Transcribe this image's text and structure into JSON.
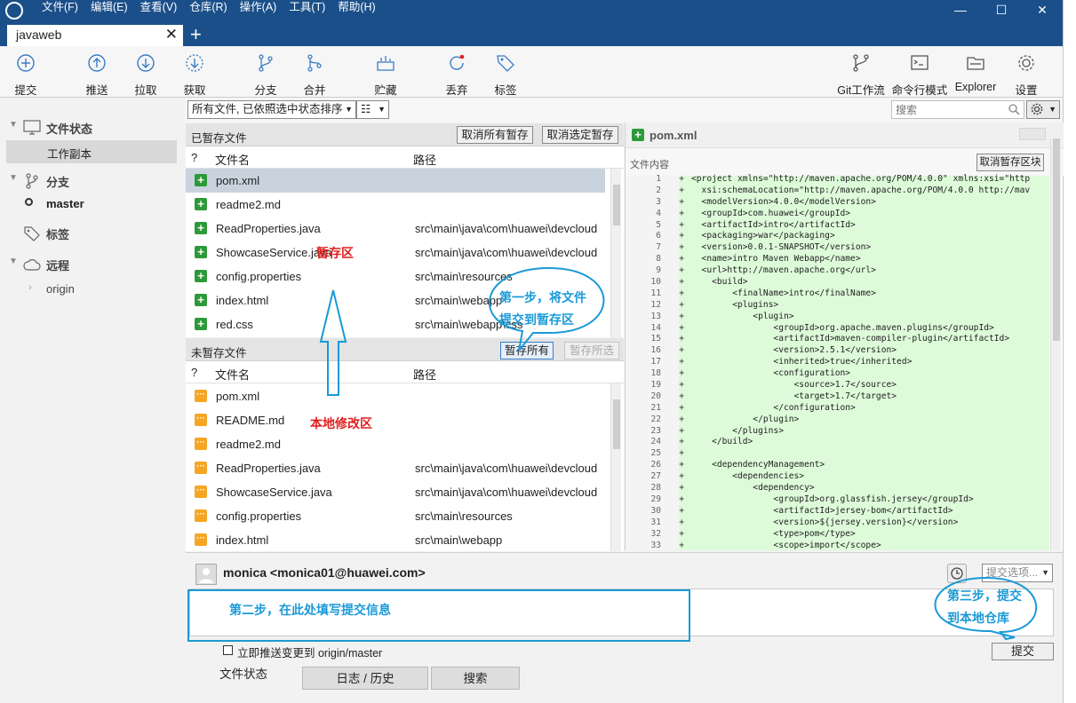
{
  "menu": [
    "文件(F)",
    "编辑(E)",
    "查看(V)",
    "仓库(R)",
    "操作(A)",
    "工具(T)",
    "帮助(H)"
  ],
  "window": {
    "minimize": "—",
    "maximize": "☐",
    "close": "✕"
  },
  "tab": {
    "label": "javaweb",
    "close": "✕",
    "add": "+"
  },
  "toolbar": {
    "commit": "提交",
    "push": "推送",
    "pull": "拉取",
    "fetch": "获取",
    "branch": "分支",
    "merge": "合并",
    "stash": "贮藏",
    "discard": "丢弃",
    "tag": "标签",
    "gitflow": "Git工作流",
    "terminal": "命令行模式",
    "explorer": "Explorer",
    "settings": "设置"
  },
  "sidebar": {
    "file_status": "文件状态",
    "working_copy": "工作副本",
    "branches": "分支",
    "master": "master",
    "tags": "标签",
    "remotes": "远程",
    "origin": "origin"
  },
  "filter": {
    "sort": "所有文件, 已依照选中状态排序",
    "list_icon": "☷",
    "search_placeholder": "搜索"
  },
  "staged": {
    "title": "已暂存文件",
    "unstage_all": "取消所有暂存",
    "unstage_selected": "取消选定暂存",
    "col_q": "?",
    "col_name": "文件名",
    "col_path": "路径",
    "files": [
      {
        "name": "pom.xml",
        "path": ""
      },
      {
        "name": "readme2.md",
        "path": ""
      },
      {
        "name": "ReadProperties.java",
        "path": "src\\main\\java\\com\\huawei\\devcloud"
      },
      {
        "name": "ShowcaseService.java",
        "path": "src\\main\\java\\com\\huawei\\devcloud"
      },
      {
        "name": "config.properties",
        "path": "src\\main\\resources"
      },
      {
        "name": "index.html",
        "path": "src\\main\\webapp"
      },
      {
        "name": "red.css",
        "path": "src\\main\\webapp\\css"
      }
    ]
  },
  "unstaged": {
    "title": "未暂存文件",
    "stage_all": "暂存所有",
    "stage_selected": "暂存所选",
    "col_q": "?",
    "col_name": "文件名",
    "col_path": "路径",
    "files": [
      {
        "name": "pom.xml",
        "path": ""
      },
      {
        "name": "README.md",
        "path": ""
      },
      {
        "name": "readme2.md",
        "path": ""
      },
      {
        "name": "ReadProperties.java",
        "path": "src\\main\\java\\com\\huawei\\devcloud"
      },
      {
        "name": "ShowcaseService.java",
        "path": "src\\main\\java\\com\\huawei\\devcloud"
      },
      {
        "name": "config.properties",
        "path": "src\\main\\resources"
      },
      {
        "name": "index.html",
        "path": "src\\main\\webapp"
      }
    ]
  },
  "diff": {
    "file": "pom.xml",
    "content_label": "文件内容",
    "unstage_hunk": "取消暂存区块",
    "lines": [
      "<project xmlns=\"http://maven.apache.org/POM/4.0.0\" xmlns:xsi=\"http",
      "  xsi:schemaLocation=\"http://maven.apache.org/POM/4.0.0 http://mav",
      "  <modelVersion>4.0.0</modelVersion>",
      "  <groupId>com.huawei</groupId>",
      "  <artifactId>intro</artifactId>",
      "  <packaging>war</packaging>",
      "  <version>0.0.1-SNAPSHOT</version>",
      "  <name>intro Maven Webapp</name>",
      "  <url>http://maven.apache.org</url>",
      "    <build>",
      "        <finalName>intro</finalName>",
      "        <plugins>",
      "            <plugin>",
      "                <groupId>org.apache.maven.plugins</groupId>",
      "                <artifactId>maven-compiler-plugin</artifactId>",
      "                <version>2.5.1</version>",
      "                <inherited>true</inherited>",
      "                <configuration>",
      "                    <source>1.7</source>",
      "                    <target>1.7</target>",
      "                </configuration>",
      "            </plugin>",
      "        </plugins>",
      "    </build>",
      "",
      "    <dependencyManagement>",
      "        <dependencies>",
      "            <dependency>",
      "                <groupId>org.glassfish.jersey</groupId>",
      "                <artifactId>jersey-bom</artifactId>",
      "                <version>${jersey.version}</version>",
      "                <type>pom</type>",
      "                <scope>import</scope>"
    ]
  },
  "commit": {
    "author": "monica <monica01@huawei.com>",
    "options": "提交选项...",
    "push_checkbox": "立即推送变更到 origin/master",
    "submit": "提交"
  },
  "annotations": {
    "staging_area": "暂存区",
    "local_changes": "本地修改区",
    "step1_line1": "第一步，将文件",
    "step1_line2": "提交到暂存区",
    "step2": "第二步，在此处填写提交信息",
    "step3_line1": "第三步，提交",
    "step3_line2": "到本地仓库"
  },
  "bottom_tabs": [
    "文件状态",
    "日志 / 历史",
    "搜索"
  ],
  "colors": {
    "titlebar": "#1a4f8a",
    "added": "#2d9a3a",
    "modified": "#f5a623",
    "diff_added_bg": "#ddfbd9",
    "annotation_blue": "#1a9ad6",
    "annotation_red": "#e02020"
  }
}
